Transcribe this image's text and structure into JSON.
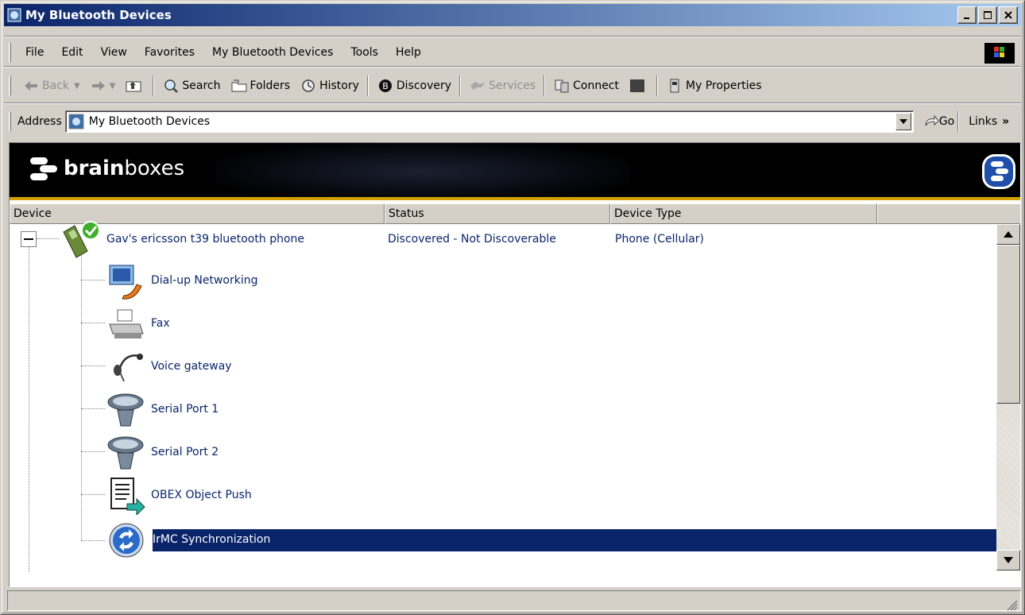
{
  "window": {
    "title": "My Bluetooth Devices"
  },
  "menu": [
    "File",
    "Edit",
    "View",
    "Favorites",
    "My Bluetooth Devices",
    "Tools",
    "Help"
  ],
  "toolbar": {
    "back": "Back",
    "search": "Search",
    "folders": "Folders",
    "history": "History",
    "discovery": "Discovery",
    "services": "Services",
    "connect": "Connect",
    "my_properties": "My Properties"
  },
  "address": {
    "label": "Address",
    "value": "My Bluetooth Devices",
    "go": "Go",
    "links": "Links"
  },
  "banner": {
    "brand_bold": "brain",
    "brand_rest": "boxes"
  },
  "columns": [
    "Device",
    "Status",
    "Device Type"
  ],
  "device": {
    "name": "Gav's ericsson t39 bluetooth phone",
    "status": "Discovered - Not Discoverable",
    "type": "Phone (Cellular)"
  },
  "services": [
    "Dial-up Networking",
    "Fax",
    "Voice gateway",
    "Serial Port 1",
    "Serial Port 2",
    "OBEX Object Push",
    "IrMC Synchronization"
  ],
  "selected_service": "IrMC Synchronization",
  "colors": {
    "title_start": "#0a246a",
    "title_end": "#a6caf0",
    "selection": "#0a246a",
    "link_text": "#0a246a",
    "banner_stripe": "#d4a000"
  }
}
